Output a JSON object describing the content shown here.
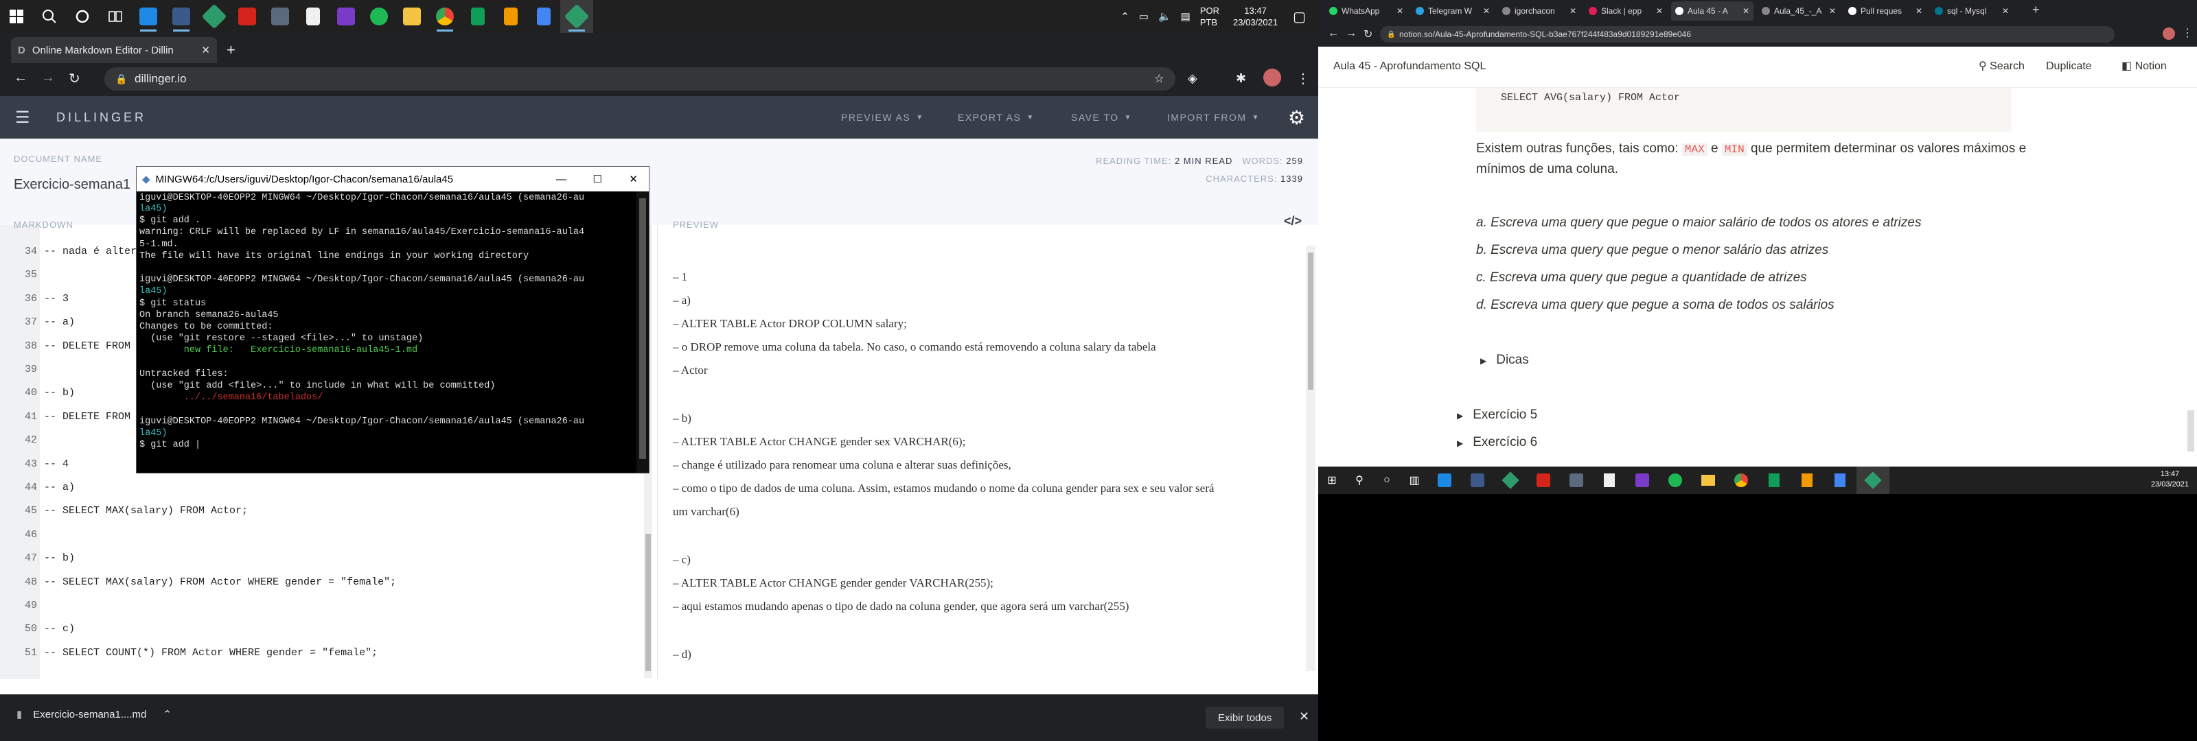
{
  "taskbar": {
    "tray": {
      "lang": "POR",
      "layout": "PTB",
      "time": "13:47",
      "date": "23/03/2021"
    }
  },
  "chrome": {
    "tab_title": "Online Markdown Editor - Dillin",
    "url": "dillinger.io"
  },
  "dillinger": {
    "logo": "DILLINGER",
    "menu": [
      "PREVIEW AS",
      "EXPORT AS",
      "SAVE TO",
      "IMPORT FROM"
    ],
    "doc_name_label": "DOCUMENT NAME",
    "doc_name": "Exercicio-semana1",
    "reading_time_label": "READING TIME:",
    "reading_time": "2 MIN READ",
    "words_label": "WORDS:",
    "words": "259",
    "characters_label": "CHARACTERS:",
    "characters": "1339",
    "markdown_label": "MARKDOWN",
    "preview_label": "PREVIEW"
  },
  "markdown_lines": [
    {
      "n": "34",
      "t": "-- nada é alter"
    },
    {
      "n": "35",
      "t": ""
    },
    {
      "n": "36",
      "t": "-- 3"
    },
    {
      "n": "37",
      "t": "-- a)"
    },
    {
      "n": "38",
      "t": "-- DELETE FROM A"
    },
    {
      "n": "39",
      "t": ""
    },
    {
      "n": "40",
      "t": "-- b)"
    },
    {
      "n": "41",
      "t": "-- DELETE FROM A"
    },
    {
      "n": "42",
      "t": ""
    },
    {
      "n": "43",
      "t": "-- 4"
    },
    {
      "n": "44",
      "t": "-- a)"
    },
    {
      "n": "45",
      "t": "-- SELECT MAX(salary) FROM Actor;"
    },
    {
      "n": "46",
      "t": ""
    },
    {
      "n": "47",
      "t": "-- b)"
    },
    {
      "n": "48",
      "t": "-- SELECT MAX(salary) FROM Actor WHERE gender = \"female\";"
    },
    {
      "n": "49",
      "t": ""
    },
    {
      "n": "50",
      "t": "-- c)"
    },
    {
      "n": "51",
      "t": "-- SELECT COUNT(*) FROM Actor WHERE gender = \"female\";"
    }
  ],
  "preview_lines": [
    "– 1",
    "– a)",
    "– ALTER TABLE Actor DROP COLUMN salary;",
    "– o DROP remove uma coluna da tabela. No caso, o comando está removendo a coluna salary da tabela",
    "– Actor",
    "– b)",
    "– ALTER TABLE Actor CHANGE gender sex VARCHAR(6);",
    "– change é utilizado para renomear uma coluna e alterar suas definições,",
    "– como o tipo de dados de uma coluna. Assim, estamos mudando o nome da coluna gender para sex e seu valor será",
    "um varchar(6)",
    "– c)",
    "– ALTER TABLE Actor CHANGE gender gender VARCHAR(255);",
    "– aqui estamos mudando apenas o tipo de dado na coluna gender, que agora será um varchar(255)",
    "– d)"
  ],
  "terminal": {
    "title": "MINGW64:/c/Users/iguvi/Desktop/Igor-Chacon/semana16/aula45",
    "lines": [
      {
        "t": "la45)",
        "c": "#3bc3c3"
      },
      {
        "t": "$ git add .",
        "c": "#ddd"
      },
      {
        "t": "warning: CRLF will be replaced by LF in semana16/aula45/Exercicio-semana16-aula4",
        "c": "#ddd"
      },
      {
        "t": "5-1.md.",
        "c": "#ddd"
      },
      {
        "t": "The file will have its original line endings in your working directory",
        "c": "#ddd"
      },
      {
        "t": "",
        "c": "#ddd"
      },
      {
        "t": "iguvi@DESKTOP-40EOPP2 MINGW64 ~/Desktop/Igor-Chacon/semana16/aula45 (semana26-au",
        "c": "#ddd"
      },
      {
        "t": "la45)",
        "c": "#3bc3c3"
      },
      {
        "t": "$ git status",
        "c": "#ddd"
      },
      {
        "t": "On branch semana26-aula45",
        "c": "#ddd"
      },
      {
        "t": "Changes to be committed:",
        "c": "#ddd"
      },
      {
        "t": "  (use \"git restore --staged <file>...\" to unstage)",
        "c": "#ddd"
      },
      {
        "t": "        new file:   Exercicio-semana16-aula45-1.md",
        "c": "#4ec94e"
      },
      {
        "t": "",
        "c": "#ddd"
      },
      {
        "t": "Untracked files:",
        "c": "#ddd"
      },
      {
        "t": "  (use \"git add <file>...\" to include in what will be committed)",
        "c": "#ddd"
      },
      {
        "t": "        ../../semana16/tabelados/",
        "c": "#d03030"
      },
      {
        "t": "",
        "c": "#ddd"
      },
      {
        "t": "iguvi@DESKTOP-40EOPP2 MINGW64 ~/Desktop/Igor-Chacon/semana16/aula45 (semana26-au",
        "c": "#ddd"
      },
      {
        "t": "la45)",
        "c": "#3bc3c3"
      },
      {
        "t": "$ git add |",
        "c": "#ddd"
      }
    ],
    "top_line": "iguvi@DESKTOP-40EOPP2 MINGW64 ~/Desktop/Igor-Chacon/semana16/aula45 (semana26-au"
  },
  "download": {
    "file": "Exercicio-semana1....md",
    "show_all": "Exibir todos"
  },
  "notion": {
    "tabs": [
      "WhatsApp",
      "Telegram W",
      "igorchacon",
      "Slack | epp",
      "Aula 45 - A",
      "Aula_45_-_A",
      "Pull reques",
      "sql - Mysql"
    ],
    "url": "notion.so/Aula-45-Aprofundamento-SQL-b3ae767f244f483a9d0189291e89e046",
    "page_title": "Aula 45 - Aprofundamento SQL",
    "search": "Search",
    "duplicate": "Duplicate",
    "notion": "Notion",
    "code_line": "SELECT AVG(salary) FROM Actor",
    "para1a": "Existem outras funções, tais como:",
    "max": "MAX",
    "and": "e",
    "min": "MIN",
    "para1b": "que permitem determinar os valores máximos e",
    "para1c": "mínimos de uma coluna.",
    "items": [
      "a. Escreva uma query que pegue o maior salário de todos os atores e atrizes",
      "b. Escreva uma query que pegue o menor salário das atrizes",
      "c. Escreva uma query que pegue a quantidade de atrizes",
      "d. Escreva uma query que pegue a soma de todos os salários"
    ],
    "dicas": "Dicas",
    "exercicio5": "Exercício 5",
    "exercicio6": "Exercício 6",
    "time": "13:47",
    "date": "23/03/2021"
  }
}
